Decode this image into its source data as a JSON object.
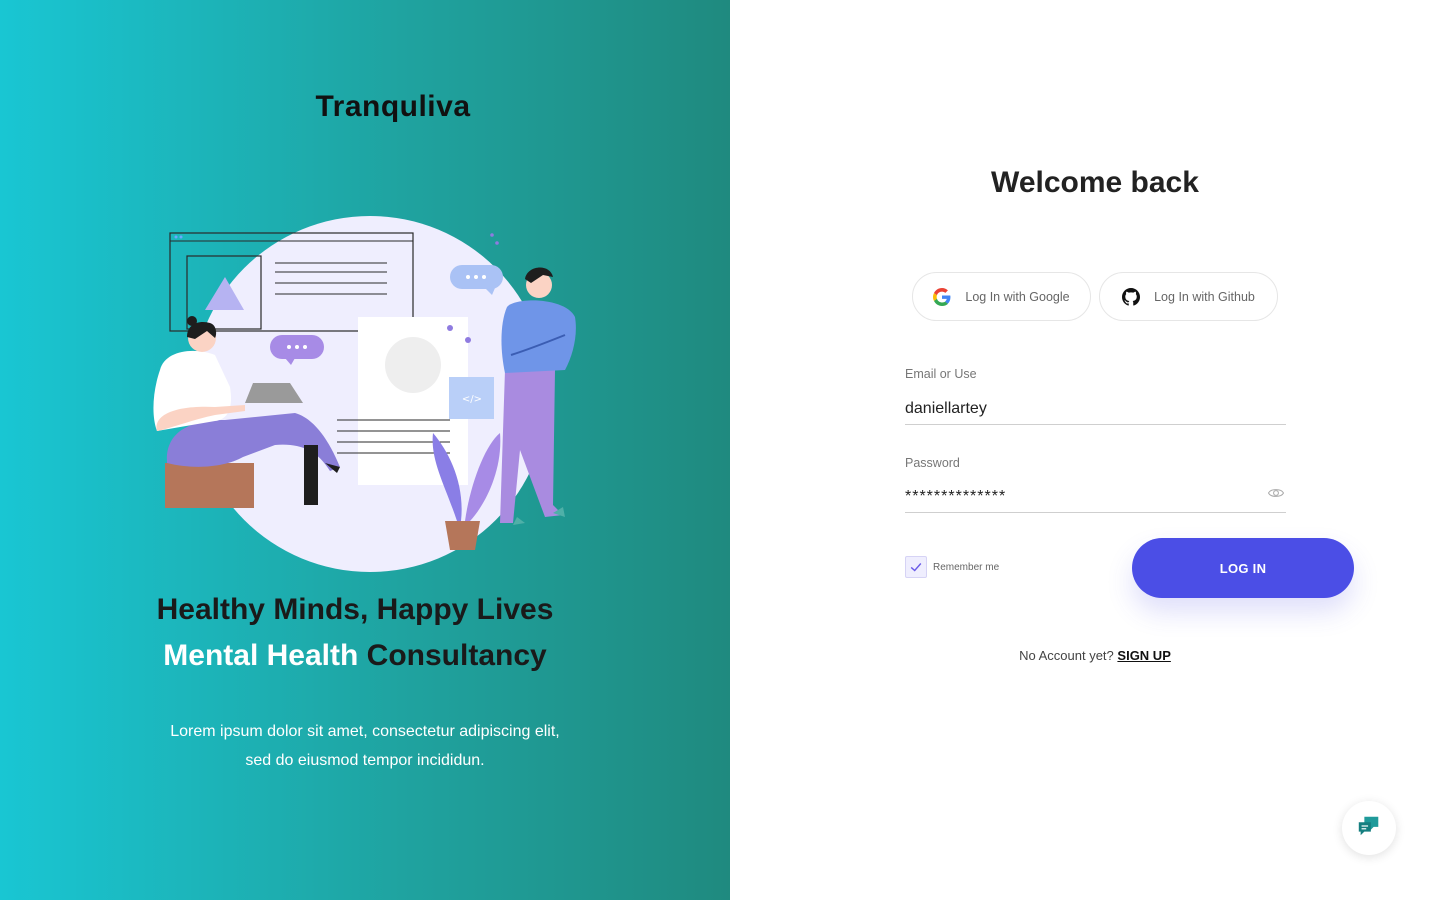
{
  "brand": {
    "name": "Tranquliva"
  },
  "hero": {
    "headline_part1": "Healthy Minds, Happy Lives",
    "headline_part2": "Mental Health",
    "headline_part3": "Consultancy",
    "subtext": "Lorem ipsum dolor sit amet, consectetur adipiscing elit, sed do eiusmod tempor incididun.",
    "illustration_bubble_code": "</>"
  },
  "login": {
    "title": "Welcome back",
    "google_label": "Log In with Google",
    "github_label": "Log In with Github",
    "email_label": "Email or Use",
    "email_value": "daniellartey",
    "password_label": "Password",
    "password_value": "**************",
    "remember_label": "Remember me",
    "remember_checked": true,
    "submit_label": "LOG IN",
    "no_account_text": "No Account yet?",
    "signup_label": "SIGN UP"
  },
  "icons": {
    "google": "google-icon",
    "github": "github-icon",
    "eye": "eye-icon",
    "check": "check-icon",
    "chat": "chat-icon"
  },
  "colors": {
    "gradient_start": "#19c6d3",
    "gradient_end": "#1f8a7f",
    "primary": "#4b4ee6",
    "chat_icon": "#1f9a9a"
  }
}
